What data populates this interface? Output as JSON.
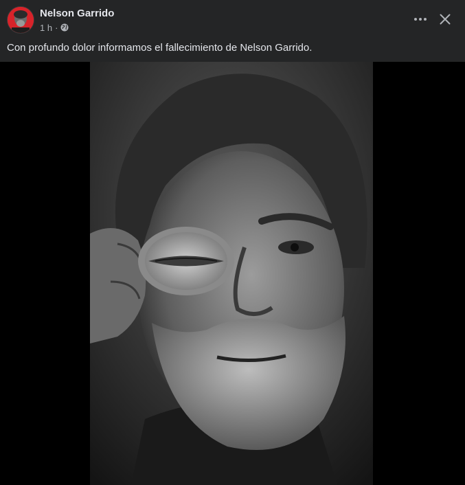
{
  "post": {
    "author": "Nelson Garrido",
    "time": "1 h",
    "separator": "·",
    "text": "Con profundo dolor informamos el fallecimiento de Nelson Garrido.",
    "audience_icon": "globe-icon"
  },
  "toolbar": {
    "more_icon": "more-horizontal-icon",
    "close_icon": "close-icon"
  },
  "colors": {
    "background": "#242526",
    "media_background": "#000000",
    "text_primary": "#e4e6eb",
    "text_secondary": "#b0b3b8",
    "avatar_accent": "#d8232a"
  }
}
